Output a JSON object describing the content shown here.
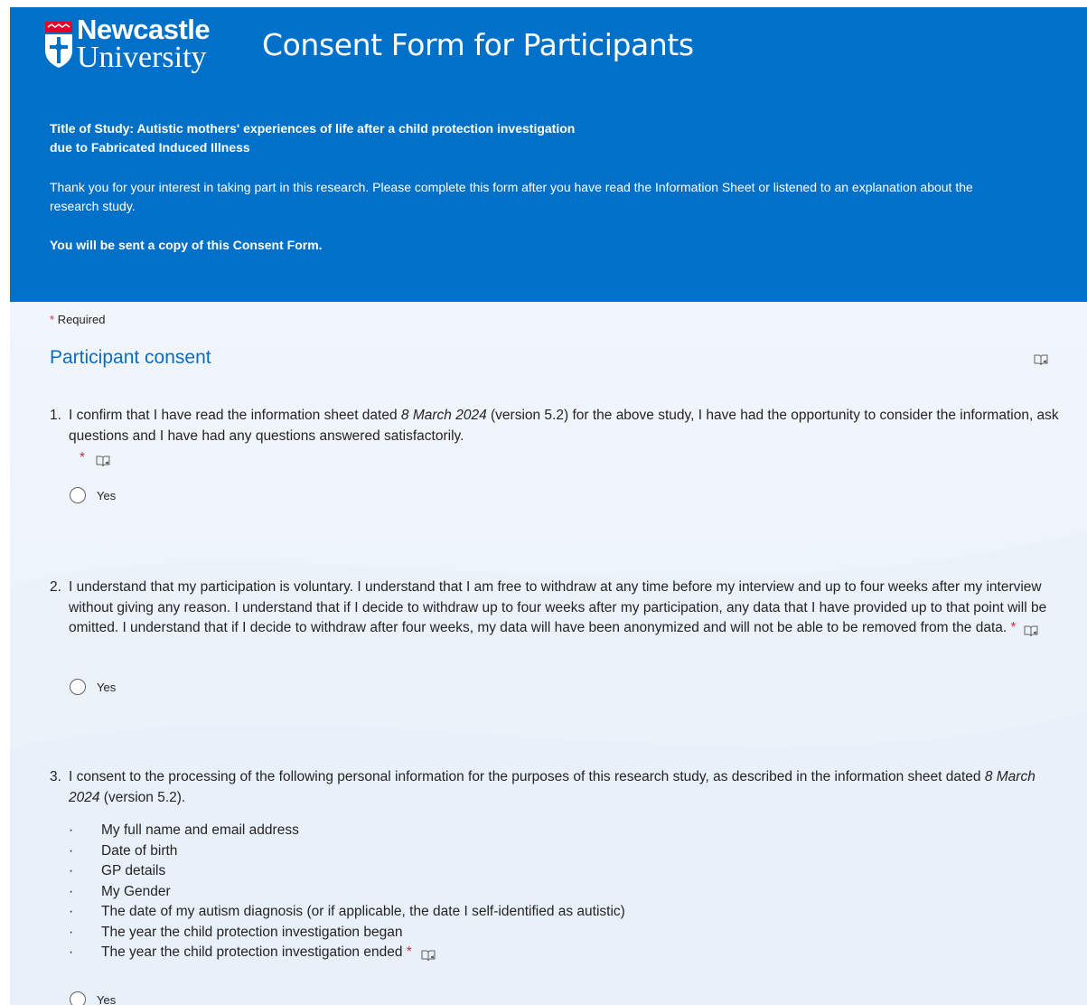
{
  "header": {
    "logo_line1": "Newcastle",
    "logo_line2": "University",
    "title": "Consent Form for Participants",
    "study_title_line1": "Title of Study: Autistic mothers' experiences of life after a child protection investigation",
    "study_title_line2": "due to Fabricated Induced Illness",
    "intro_line1": "Thank you for your interest in taking part in this research. Please complete this form after you have read the Information Sheet or listened to an explanation about the",
    "intro_line2": "research study.",
    "copy_note": "You will be sent a copy of this Consent Form."
  },
  "required_note": {
    "star": "*",
    "text": "Required"
  },
  "section": {
    "title": "Participant consent",
    "reader_icon": "immersive-reader-icon"
  },
  "questions": [
    {
      "number": "1.",
      "text_before": "I confirm that I have read the information sheet dated ",
      "date": "8 March 2024",
      "text_after": " (version 5.2) for the above study, I have had the opportunity to consider the information, ask questions and I have had any questions answered satisfactorily.",
      "required_star": "*",
      "option": "Yes"
    },
    {
      "number": "2.",
      "text": "I understand that my participation is voluntary. I understand that I am free to withdraw at any time before my interview and up to four weeks after my interview without giving any reason. I understand that if I decide to withdraw up to four weeks after my participation, any data that I have provided up to that point will be omitted. I understand that if I decide to withdraw after four weeks, my data will have been anonymized and will not be able to be removed from the data.",
      "required_star": "*",
      "option": "Yes"
    },
    {
      "number": "3.",
      "text_before": "I consent to the processing of the following personal information for the purposes of this research study, as described in the information sheet dated ",
      "date": "8 March 2024",
      "text_after": " (version 5.2).",
      "bullet_glyph": "·",
      "bullets": [
        "My full name and email address",
        "Date of birth",
        "GP details",
        "My Gender",
        "The date of my autism diagnosis (or if applicable, the date I self-identified as autistic)",
        "The year the child protection investigation began",
        "The year the child protection investigation ended"
      ],
      "required_star": "*",
      "option": "Yes"
    }
  ],
  "colors": {
    "header_bg": "#0070c8",
    "accent": "#0f6cbd",
    "required": "#c4314b",
    "page_bg": "#f3f7fc"
  }
}
